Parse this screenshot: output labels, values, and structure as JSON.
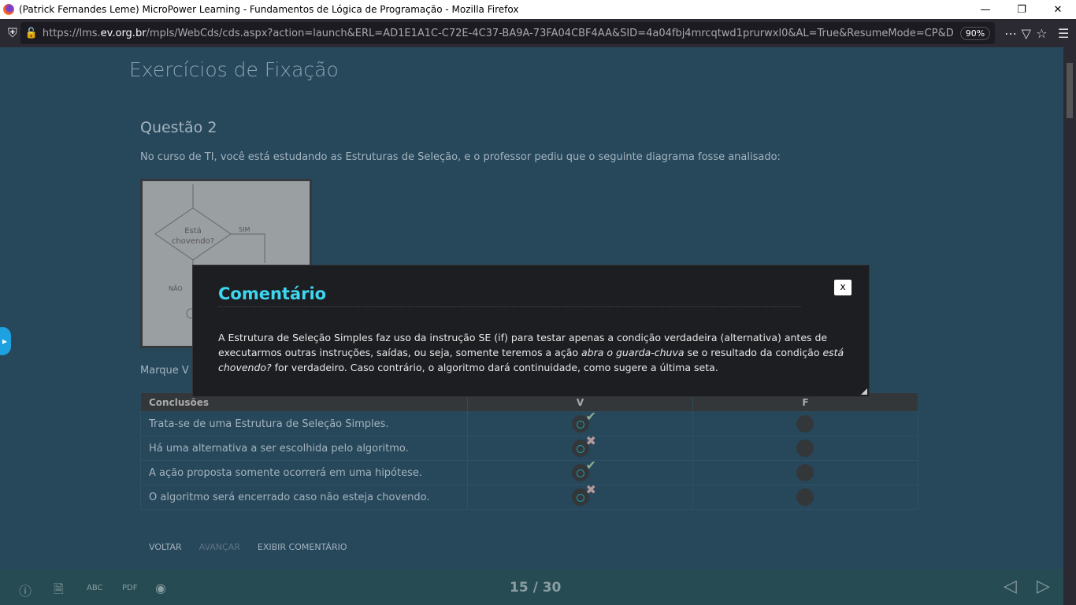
{
  "browser": {
    "title": "(Patrick Fernandes Leme) MicroPower Learning - Fundamentos de Lógica de Programação - Mozilla Firefox",
    "url_prefix": "https://lms.",
    "url_domain": "ev.org.br",
    "url_rest": "/mpls/WebCds/cds.aspx?action=launch&ERL=AD1E1A1C-C72E-4C37-BA9A-73FA04CBF4AA&SID=4a04fbj4mrcqtwd1prurwxl0&AL=True&ResumeMode=CP&D",
    "zoom": "90%"
  },
  "page": {
    "heading": "Exercícios de Fixação",
    "question_title": "Questão 2",
    "intro": "No curso de TI, você está estudando as Estruturas de Seleção, e o professor pediu que o seguinte diagrama fosse analisado:",
    "instruction_partial": "Marque V p"
  },
  "diagram": {
    "decision": "Está",
    "decision2": "chovendo?",
    "yes": "SIM",
    "no": "NÃO"
  },
  "table": {
    "headers": [
      "Conclusões",
      "V",
      "F"
    ],
    "rows": [
      {
        "text": "Trata-se de uma Estrutura de Seleção Simples.",
        "selected": "V",
        "result": "correct"
      },
      {
        "text": "Há uma alternativa a ser escolhida pelo algoritmo.",
        "selected": "V",
        "result": "wrong"
      },
      {
        "text": "A ação proposta somente ocorrerá em uma hipótese.",
        "selected": "V",
        "result": "correct"
      },
      {
        "text": "O algoritmo será encerrado caso não esteja chovendo.",
        "selected": "V",
        "result": "wrong"
      }
    ]
  },
  "buttons": {
    "back": "VOLTAR",
    "next": "AVANÇAR",
    "comment": "EXIBIR COMENTÁRIO"
  },
  "footer": {
    "pager": "15 / 30"
  },
  "modal": {
    "title": "Comentário",
    "close": "x",
    "t1": "A Estrutura de Seleção Simples faz uso da instrução SE (if) para testar apenas a condição verdadeira (alternativa) antes de executarmos outras instruções, saídas, ou seja, somente teremos a ação ",
    "em1": "abra o guarda-chuva",
    "t2": " se o resultado da condição ",
    "em2": "está chovendo?",
    "t3": " for verdadeiro. Caso contrário, o algoritmo dará continuidade, como sugere a última seta."
  }
}
